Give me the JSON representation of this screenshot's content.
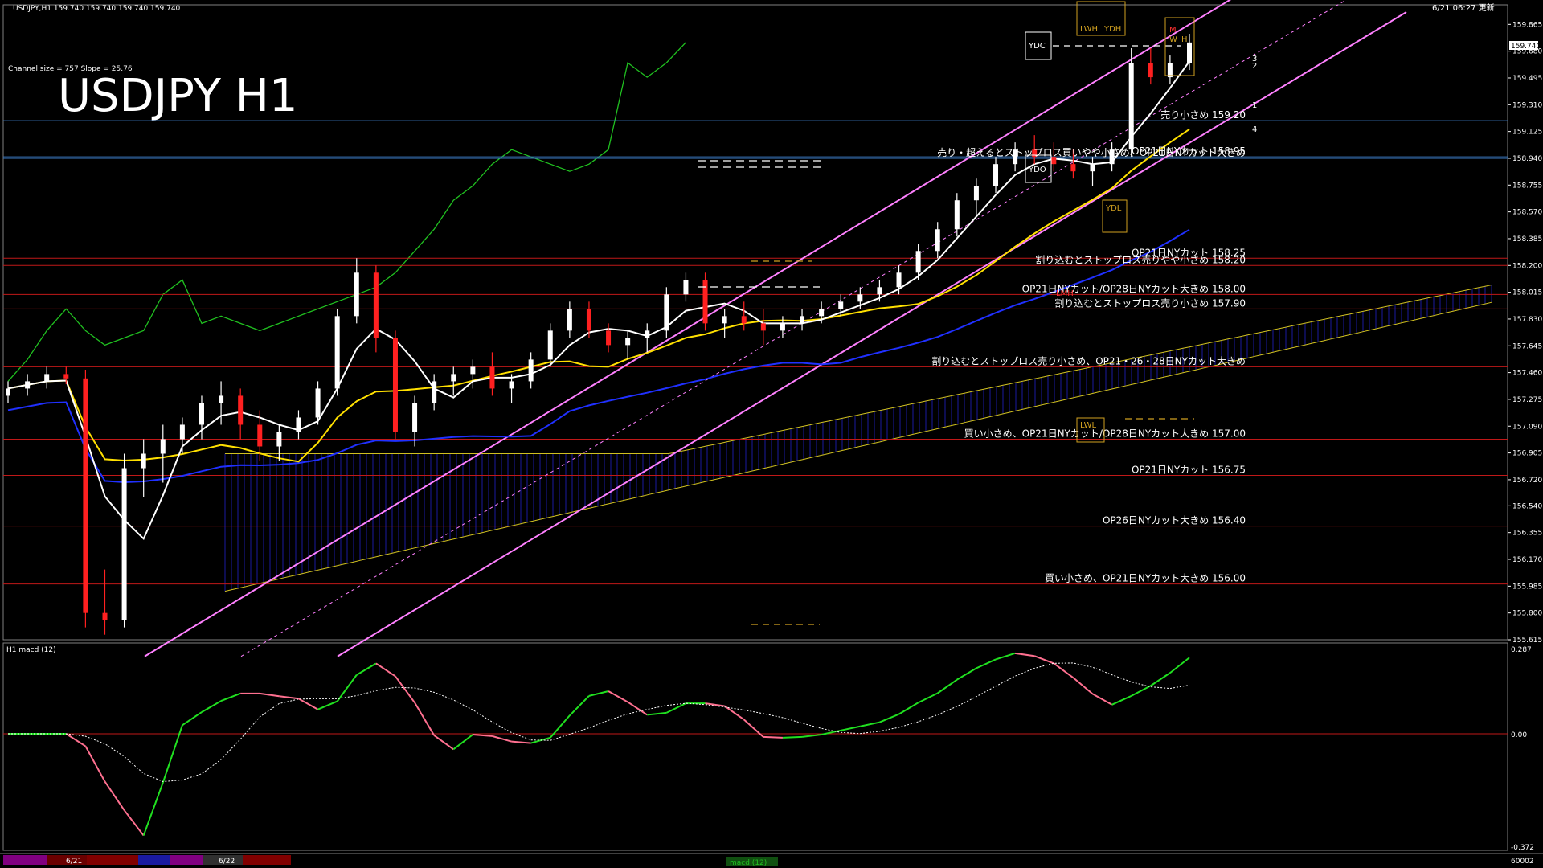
{
  "window": {
    "header_left": "USDJPY,H1  159.740 159.740 159.740 159.740",
    "header_right": "6/21 06:27 更新",
    "title": "USDJPY H1",
    "channel_info": "Channel size = 757 Slope = 25.76"
  },
  "colors": {
    "background": "#000000",
    "bull_candle": "#ffffff",
    "bear_candle": "#ff2020",
    "level_line_red": "#c01818",
    "level_line_blue": "#3a78c0",
    "channel": "#ff80ff",
    "ma_white": "#ffffff",
    "ma_yellow": "#ffe000",
    "ma_blue": "#2030ff",
    "chikou_green": "#20c020",
    "kumo_blue": "#1a1aa0",
    "kumo_edge": "#d0c020",
    "macd_up": "#20e020",
    "macd_down": "#ff7090",
    "signal": "#ffffff",
    "zero_line": "#c01818"
  },
  "price_axis": {
    "labels": [
      "159.865",
      "159.680",
      "159.495",
      "159.310",
      "159.125",
      "158.940",
      "158.755",
      "158.570",
      "158.385",
      "158.200",
      "158.015",
      "157.830",
      "157.645",
      "157.460",
      "157.275",
      "157.090",
      "156.905",
      "156.720",
      "156.540",
      "156.355",
      "156.170",
      "155.985",
      "155.800",
      "155.615"
    ],
    "current_price": "159.740"
  },
  "levels": [
    {
      "price": 159.2,
      "text": "売り小さめ 159.20",
      "color": "#3a78c0"
    },
    {
      "price": 158.95,
      "text": "OP21日NYカット 158.95",
      "color": "#3a78c0"
    },
    {
      "price": 158.94,
      "text": "売り・超えるとストップロス買いやや小さめ、OP21日NYカット大きめ",
      "color": "#3a78c0"
    },
    {
      "price": 158.25,
      "text": "OP21日NYカット 158.25",
      "color": "#c01818"
    },
    {
      "price": 158.2,
      "text": "割り込むとストップロス売りやや小さめ 158.20",
      "color": "#c01818"
    },
    {
      "price": 158.0,
      "text": "OP21日NYカット/OP28日NYカット大きめ 158.00",
      "color": "#c01818"
    },
    {
      "price": 157.9,
      "text": "割り込むとストップロス売り小さめ 157.90",
      "color": "#c01818"
    },
    {
      "price": 157.5,
      "text": "割り込むとストップロス売り小さめ、OP21・26・28日NYカット大きめ",
      "color": "#c01818"
    },
    {
      "price": 157.0,
      "text": "買い小さめ、OP21日NYカット/OP28日NYカット大きめ 157.00",
      "color": "#c01818"
    },
    {
      "price": 156.75,
      "text": "OP21日NYカット 156.75",
      "color": "#c01818"
    },
    {
      "price": 156.4,
      "text": "OP26日NYカット大きめ 156.40",
      "color": "#c01818"
    },
    {
      "price": 156.0,
      "text": "買い小さめ、OP21日NYカット大きめ 156.00",
      "color": "#c01818"
    }
  ],
  "tags": {
    "ydc": "YDC",
    "ydo": "YDO",
    "ydh": "YDH",
    "ydl": "YDL",
    "lwh": "LWH",
    "lwl": "LWL",
    "lmh": "LMH",
    "m": "M",
    "w": "W",
    "h": "H"
  },
  "channel_numbers": [
    "3",
    "2",
    "1",
    "4"
  ],
  "macd_panel": {
    "label": "H1  macd (12)",
    "axis": [
      "0.287",
      "0.00",
      "-0.372"
    ]
  },
  "time_axis": {
    "labels": [
      "6/21",
      "6/22"
    ],
    "bottom_right": "60002",
    "center_label": "macd (12)"
  },
  "chart_data": {
    "type": "candlestick",
    "title": "USDJPY H1",
    "symbol": "USDJPY",
    "timeframe": "H1",
    "ylim": [
      155.615,
      160.0
    ],
    "candles": [
      [
        157.3,
        157.4,
        157.25,
        157.35
      ],
      [
        157.35,
        157.45,
        157.3,
        157.4
      ],
      [
        157.4,
        157.5,
        157.35,
        157.45
      ],
      [
        157.45,
        157.5,
        157.38,
        157.42
      ],
      [
        157.42,
        157.48,
        155.7,
        155.8
      ],
      [
        155.8,
        156.1,
        155.65,
        155.75
      ],
      [
        155.75,
        156.9,
        155.7,
        156.8
      ],
      [
        156.8,
        157.0,
        156.6,
        156.9
      ],
      [
        156.9,
        157.1,
        156.7,
        157.0
      ],
      [
        157.0,
        157.15,
        156.9,
        157.1
      ],
      [
        157.1,
        157.3,
        157.0,
        157.25
      ],
      [
        157.25,
        157.4,
        157.1,
        157.3
      ],
      [
        157.3,
        157.35,
        157.0,
        157.1
      ],
      [
        157.1,
        157.2,
        156.85,
        156.95
      ],
      [
        156.95,
        157.1,
        156.85,
        157.05
      ],
      [
        157.05,
        157.2,
        157.0,
        157.15
      ],
      [
        157.15,
        157.4,
        157.1,
        157.35
      ],
      [
        157.35,
        157.9,
        157.3,
        157.85
      ],
      [
        157.85,
        158.25,
        157.8,
        158.15
      ],
      [
        158.15,
        158.2,
        157.6,
        157.7
      ],
      [
        157.7,
        157.75,
        157.0,
        157.05
      ],
      [
        157.05,
        157.3,
        156.95,
        157.25
      ],
      [
        157.25,
        157.45,
        157.2,
        157.4
      ],
      [
        157.4,
        157.5,
        157.3,
        157.45
      ],
      [
        157.45,
        157.55,
        157.35,
        157.5
      ],
      [
        157.5,
        157.6,
        157.3,
        157.35
      ],
      [
        157.35,
        157.45,
        157.25,
        157.4
      ],
      [
        157.4,
        157.6,
        157.35,
        157.55
      ],
      [
        157.55,
        157.8,
        157.5,
        157.75
      ],
      [
        157.75,
        157.95,
        157.7,
        157.9
      ],
      [
        157.9,
        157.95,
        157.7,
        157.75
      ],
      [
        157.75,
        157.8,
        157.6,
        157.65
      ],
      [
        157.65,
        157.75,
        157.55,
        157.7
      ],
      [
        157.7,
        157.8,
        157.6,
        157.75
      ],
      [
        157.75,
        158.05,
        157.7,
        158.0
      ],
      [
        158.0,
        158.15,
        157.95,
        158.1
      ],
      [
        158.1,
        158.15,
        157.75,
        157.8
      ],
      [
        157.8,
        157.9,
        157.7,
        157.85
      ],
      [
        157.85,
        157.95,
        157.75,
        157.8
      ],
      [
        157.8,
        157.9,
        157.65,
        157.75
      ],
      [
        157.75,
        157.85,
        157.7,
        157.8
      ],
      [
        157.8,
        157.9,
        157.75,
        157.85
      ],
      [
        157.85,
        157.95,
        157.8,
        157.9
      ],
      [
        157.9,
        158.0,
        157.85,
        157.95
      ],
      [
        157.95,
        158.05,
        157.9,
        158.0
      ],
      [
        158.0,
        158.1,
        157.95,
        158.05
      ],
      [
        158.05,
        158.2,
        158.0,
        158.15
      ],
      [
        158.15,
        158.35,
        158.1,
        158.3
      ],
      [
        158.3,
        158.5,
        158.25,
        158.45
      ],
      [
        158.45,
        158.7,
        158.4,
        158.65
      ],
      [
        158.65,
        158.8,
        158.55,
        158.75
      ],
      [
        158.75,
        158.95,
        158.7,
        158.9
      ],
      [
        158.9,
        159.05,
        158.85,
        159.0
      ],
      [
        159.0,
        159.1,
        158.9,
        158.95
      ],
      [
        158.95,
        159.05,
        158.85,
        158.9
      ],
      [
        158.9,
        159.0,
        158.8,
        158.85
      ],
      [
        158.85,
        158.95,
        158.75,
        158.9
      ],
      [
        158.9,
        159.05,
        158.85,
        159.0
      ],
      [
        159.0,
        159.7,
        158.95,
        159.6
      ],
      [
        159.6,
        159.7,
        159.45,
        159.5
      ],
      [
        159.5,
        159.65,
        159.45,
        159.6
      ],
      [
        159.6,
        159.8,
        159.55,
        159.74
      ]
    ]
  }
}
